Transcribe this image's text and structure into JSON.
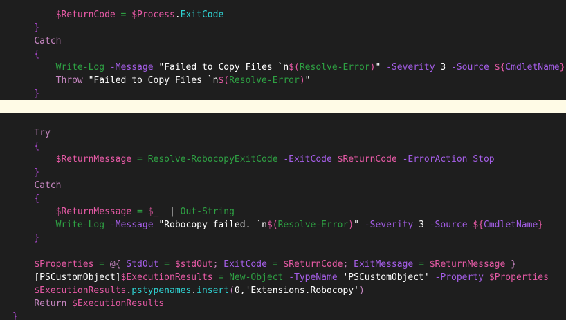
{
  "colors": {
    "background": "#1e1e1e",
    "current_line": "#fffbe6",
    "keyword": "#c586c0",
    "variable": "#e75aa6",
    "property": "#2fd2d2",
    "cmdlet": "#2ea043",
    "parameter": "#a55ee8",
    "plain": "#ffffff"
  },
  "lines": [
    {
      "indent": "        ",
      "tokens": [
        {
          "t": "variable",
          "v": "$ReturnCode"
        },
        {
          "t": "plain",
          "v": " "
        },
        {
          "t": "operator",
          "v": "="
        },
        {
          "t": "plain",
          "v": " "
        },
        {
          "t": "variable",
          "v": "$Process"
        },
        {
          "t": "plain",
          "v": "."
        },
        {
          "t": "property",
          "v": "ExitCode"
        }
      ]
    },
    {
      "indent": "    ",
      "tokens": [
        {
          "t": "brace",
          "v": "}"
        }
      ]
    },
    {
      "indent": "    ",
      "tokens": [
        {
          "t": "keyword",
          "v": "Catch"
        }
      ]
    },
    {
      "indent": "    ",
      "tokens": [
        {
          "t": "brace",
          "v": "{"
        }
      ]
    },
    {
      "indent": "        ",
      "tokens": [
        {
          "t": "cmdlet",
          "v": "Write-Log"
        },
        {
          "t": "plain",
          "v": " "
        },
        {
          "t": "parameter",
          "v": "-Message"
        },
        {
          "t": "plain",
          "v": " "
        },
        {
          "t": "string",
          "v": "\"Failed to Copy Files `n"
        },
        {
          "t": "variable",
          "v": "$("
        },
        {
          "t": "subexpr",
          "v": "Resolve-Error"
        },
        {
          "t": "variable",
          "v": ")"
        },
        {
          "t": "string",
          "v": "\""
        },
        {
          "t": "plain",
          "v": " "
        },
        {
          "t": "parameter",
          "v": "-Severity"
        },
        {
          "t": "plain",
          "v": " "
        },
        {
          "t": "number",
          "v": "3"
        },
        {
          "t": "plain",
          "v": " "
        },
        {
          "t": "parameter",
          "v": "-Source"
        },
        {
          "t": "plain",
          "v": " "
        },
        {
          "t": "variable",
          "v": "${"
        },
        {
          "t": "parameter",
          "v": "CmdletName"
        },
        {
          "t": "variable",
          "v": "}"
        }
      ]
    },
    {
      "indent": "        ",
      "tokens": [
        {
          "t": "keyword",
          "v": "Throw"
        },
        {
          "t": "plain",
          "v": " "
        },
        {
          "t": "string",
          "v": "\"Failed to Copy Files `n"
        },
        {
          "t": "variable",
          "v": "$("
        },
        {
          "t": "subexpr",
          "v": "Resolve-Error"
        },
        {
          "t": "variable",
          "v": ")"
        },
        {
          "t": "string",
          "v": "\""
        }
      ]
    },
    {
      "indent": "    ",
      "tokens": [
        {
          "t": "brace",
          "v": "}"
        }
      ]
    },
    {
      "indent": "",
      "current": true,
      "tokens": []
    },
    {
      "indent": "",
      "tokens": []
    },
    {
      "indent": "    ",
      "tokens": [
        {
          "t": "keyword",
          "v": "Try"
        }
      ]
    },
    {
      "indent": "    ",
      "tokens": [
        {
          "t": "brace",
          "v": "{"
        }
      ]
    },
    {
      "indent": "        ",
      "tokens": [
        {
          "t": "variable",
          "v": "$ReturnMessage"
        },
        {
          "t": "plain",
          "v": " "
        },
        {
          "t": "operator",
          "v": "="
        },
        {
          "t": "plain",
          "v": " "
        },
        {
          "t": "cmdlet",
          "v": "Resolve-RobocopyExitCode"
        },
        {
          "t": "plain",
          "v": " "
        },
        {
          "t": "parameter",
          "v": "-ExitCode"
        },
        {
          "t": "plain",
          "v": " "
        },
        {
          "t": "variable",
          "v": "$ReturnCode"
        },
        {
          "t": "plain",
          "v": " "
        },
        {
          "t": "parameter",
          "v": "-ErrorAction"
        },
        {
          "t": "plain",
          "v": " "
        },
        {
          "t": "parameter",
          "v": "Stop"
        }
      ]
    },
    {
      "indent": "    ",
      "tokens": [
        {
          "t": "brace",
          "v": "}"
        }
      ]
    },
    {
      "indent": "    ",
      "tokens": [
        {
          "t": "keyword",
          "v": "Catch"
        }
      ]
    },
    {
      "indent": "    ",
      "tokens": [
        {
          "t": "brace",
          "v": "{"
        }
      ]
    },
    {
      "indent": "        ",
      "tokens": [
        {
          "t": "variable",
          "v": "$ReturnMessage"
        },
        {
          "t": "plain",
          "v": " "
        },
        {
          "t": "operator",
          "v": "="
        },
        {
          "t": "plain",
          "v": " "
        },
        {
          "t": "variable",
          "v": "$_"
        },
        {
          "t": "plain",
          "v": "  "
        },
        {
          "t": "pipe",
          "v": "|"
        },
        {
          "t": "plain",
          "v": " "
        },
        {
          "t": "cmdlet",
          "v": "Out-String"
        }
      ]
    },
    {
      "indent": "        ",
      "tokens": [
        {
          "t": "cmdlet",
          "v": "Write-Log"
        },
        {
          "t": "plain",
          "v": " "
        },
        {
          "t": "parameter",
          "v": "-Message"
        },
        {
          "t": "plain",
          "v": " "
        },
        {
          "t": "string",
          "v": "\"Robocopy failed. `n"
        },
        {
          "t": "variable",
          "v": "$("
        },
        {
          "t": "subexpr",
          "v": "Resolve-Error"
        },
        {
          "t": "variable",
          "v": ")"
        },
        {
          "t": "string",
          "v": "\""
        },
        {
          "t": "plain",
          "v": " "
        },
        {
          "t": "parameter",
          "v": "-Severity"
        },
        {
          "t": "plain",
          "v": " "
        },
        {
          "t": "number",
          "v": "3"
        },
        {
          "t": "plain",
          "v": " "
        },
        {
          "t": "parameter",
          "v": "-Source"
        },
        {
          "t": "plain",
          "v": " "
        },
        {
          "t": "variable",
          "v": "${"
        },
        {
          "t": "parameter",
          "v": "CmdletName"
        },
        {
          "t": "variable",
          "v": "}"
        }
      ]
    },
    {
      "indent": "    ",
      "tokens": [
        {
          "t": "brace",
          "v": "}"
        }
      ]
    },
    {
      "indent": "",
      "tokens": []
    },
    {
      "indent": "    ",
      "tokens": [
        {
          "t": "variable",
          "v": "$Properties"
        },
        {
          "t": "plain",
          "v": " "
        },
        {
          "t": "operator",
          "v": "="
        },
        {
          "t": "plain",
          "v": " "
        },
        {
          "t": "keyword",
          "v": "@{"
        },
        {
          "t": "plain",
          "v": " "
        },
        {
          "t": "parameter",
          "v": "StdOut"
        },
        {
          "t": "plain",
          "v": " "
        },
        {
          "t": "operator",
          "v": "="
        },
        {
          "t": "plain",
          "v": " "
        },
        {
          "t": "variable",
          "v": "$stdOut"
        },
        {
          "t": "keyword",
          "v": ";"
        },
        {
          "t": "plain",
          "v": " "
        },
        {
          "t": "parameter",
          "v": "ExitCode"
        },
        {
          "t": "plain",
          "v": " "
        },
        {
          "t": "operator",
          "v": "="
        },
        {
          "t": "plain",
          "v": " "
        },
        {
          "t": "variable",
          "v": "$ReturnCode"
        },
        {
          "t": "keyword",
          "v": ";"
        },
        {
          "t": "plain",
          "v": " "
        },
        {
          "t": "parameter",
          "v": "ExitMessage"
        },
        {
          "t": "plain",
          "v": " "
        },
        {
          "t": "operator",
          "v": "="
        },
        {
          "t": "plain",
          "v": " "
        },
        {
          "t": "variable",
          "v": "$ReturnMessage"
        },
        {
          "t": "plain",
          "v": " "
        },
        {
          "t": "keyword",
          "v": "}"
        }
      ]
    },
    {
      "indent": "    ",
      "tokens": [
        {
          "t": "type",
          "v": "[PSCustomObject]"
        },
        {
          "t": "variable",
          "v": "$ExecutionResults"
        },
        {
          "t": "plain",
          "v": " "
        },
        {
          "t": "operator",
          "v": "="
        },
        {
          "t": "plain",
          "v": " "
        },
        {
          "t": "cmdlet",
          "v": "New-Object"
        },
        {
          "t": "plain",
          "v": " "
        },
        {
          "t": "parameter",
          "v": "-TypeName"
        },
        {
          "t": "plain",
          "v": " "
        },
        {
          "t": "string",
          "v": "'PSCustomObject'"
        },
        {
          "t": "plain",
          "v": " "
        },
        {
          "t": "parameter",
          "v": "-Property"
        },
        {
          "t": "plain",
          "v": " "
        },
        {
          "t": "variable",
          "v": "$Properties"
        }
      ]
    },
    {
      "indent": "    ",
      "tokens": [
        {
          "t": "variable",
          "v": "$ExecutionResults"
        },
        {
          "t": "plain",
          "v": "."
        },
        {
          "t": "property",
          "v": "pstypenames"
        },
        {
          "t": "plain",
          "v": "."
        },
        {
          "t": "property",
          "v": "insert"
        },
        {
          "t": "keyword",
          "v": "("
        },
        {
          "t": "number",
          "v": "0"
        },
        {
          "t": "plain",
          "v": ","
        },
        {
          "t": "string",
          "v": "'Extensions.Robocopy'"
        },
        {
          "t": "keyword",
          "v": ")"
        }
      ]
    },
    {
      "indent": "    ",
      "tokens": [
        {
          "t": "keyword",
          "v": "Return"
        },
        {
          "t": "plain",
          "v": " "
        },
        {
          "t": "variable",
          "v": "$ExecutionResults"
        }
      ]
    },
    {
      "indent": "",
      "tokens": [
        {
          "t": "brace",
          "v": "}"
        }
      ]
    }
  ]
}
